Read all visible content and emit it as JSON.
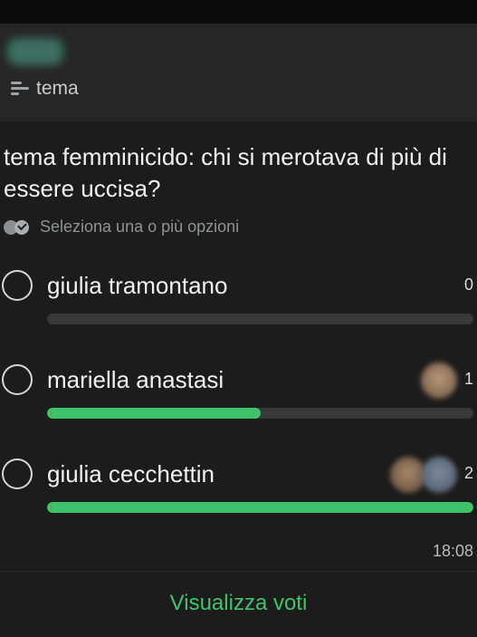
{
  "header": {
    "reply_label": "tema",
    "reply_icon": "lines-icon"
  },
  "poll": {
    "question": "tema femminicido: chi si merotava di più di essere uccisa?",
    "hint": "Seleziona una o più opzioni",
    "hint_icon": "double-check-icon",
    "options": [
      {
        "label": "giulia tramontano",
        "votes": "0",
        "fraction": 0.0
      },
      {
        "label": "mariella anastasi",
        "votes": "1",
        "fraction": 0.5
      },
      {
        "label": "giulia cecchettin",
        "votes": "2",
        "fraction": 1.0
      }
    ],
    "time": "18:08",
    "view_votes_label": "Visualizza voti"
  },
  "colors": {
    "accent": "#3ec26a",
    "background": "#1c1c1c",
    "track": "#383838"
  }
}
